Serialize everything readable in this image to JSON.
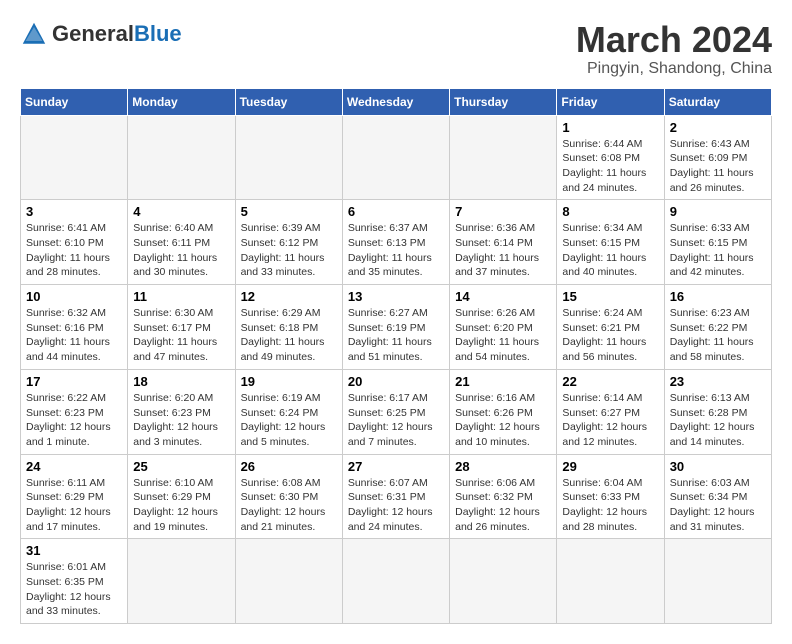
{
  "header": {
    "logo_text_general": "General",
    "logo_text_blue": "Blue",
    "month_title": "March 2024",
    "location": "Pingyin, Shandong, China"
  },
  "days_of_week": [
    "Sunday",
    "Monday",
    "Tuesday",
    "Wednesday",
    "Thursday",
    "Friday",
    "Saturday"
  ],
  "weeks": [
    [
      {
        "day": "",
        "empty": true
      },
      {
        "day": "",
        "empty": true
      },
      {
        "day": "",
        "empty": true
      },
      {
        "day": "",
        "empty": true
      },
      {
        "day": "",
        "empty": true
      },
      {
        "day": "1",
        "sunrise": "6:44 AM",
        "sunset": "6:08 PM",
        "daylight": "11 hours and 24 minutes."
      },
      {
        "day": "2",
        "sunrise": "6:43 AM",
        "sunset": "6:09 PM",
        "daylight": "11 hours and 26 minutes."
      }
    ],
    [
      {
        "day": "3",
        "sunrise": "6:41 AM",
        "sunset": "6:10 PM",
        "daylight": "11 hours and 28 minutes."
      },
      {
        "day": "4",
        "sunrise": "6:40 AM",
        "sunset": "6:11 PM",
        "daylight": "11 hours and 30 minutes."
      },
      {
        "day": "5",
        "sunrise": "6:39 AM",
        "sunset": "6:12 PM",
        "daylight": "11 hours and 33 minutes."
      },
      {
        "day": "6",
        "sunrise": "6:37 AM",
        "sunset": "6:13 PM",
        "daylight": "11 hours and 35 minutes."
      },
      {
        "day": "7",
        "sunrise": "6:36 AM",
        "sunset": "6:14 PM",
        "daylight": "11 hours and 37 minutes."
      },
      {
        "day": "8",
        "sunrise": "6:34 AM",
        "sunset": "6:15 PM",
        "daylight": "11 hours and 40 minutes."
      },
      {
        "day": "9",
        "sunrise": "6:33 AM",
        "sunset": "6:15 PM",
        "daylight": "11 hours and 42 minutes."
      }
    ],
    [
      {
        "day": "10",
        "sunrise": "6:32 AM",
        "sunset": "6:16 PM",
        "daylight": "11 hours and 44 minutes."
      },
      {
        "day": "11",
        "sunrise": "6:30 AM",
        "sunset": "6:17 PM",
        "daylight": "11 hours and 47 minutes."
      },
      {
        "day": "12",
        "sunrise": "6:29 AM",
        "sunset": "6:18 PM",
        "daylight": "11 hours and 49 minutes."
      },
      {
        "day": "13",
        "sunrise": "6:27 AM",
        "sunset": "6:19 PM",
        "daylight": "11 hours and 51 minutes."
      },
      {
        "day": "14",
        "sunrise": "6:26 AM",
        "sunset": "6:20 PM",
        "daylight": "11 hours and 54 minutes."
      },
      {
        "day": "15",
        "sunrise": "6:24 AM",
        "sunset": "6:21 PM",
        "daylight": "11 hours and 56 minutes."
      },
      {
        "day": "16",
        "sunrise": "6:23 AM",
        "sunset": "6:22 PM",
        "daylight": "11 hours and 58 minutes."
      }
    ],
    [
      {
        "day": "17",
        "sunrise": "6:22 AM",
        "sunset": "6:23 PM",
        "daylight": "12 hours and 1 minute."
      },
      {
        "day": "18",
        "sunrise": "6:20 AM",
        "sunset": "6:23 PM",
        "daylight": "12 hours and 3 minutes."
      },
      {
        "day": "19",
        "sunrise": "6:19 AM",
        "sunset": "6:24 PM",
        "daylight": "12 hours and 5 minutes."
      },
      {
        "day": "20",
        "sunrise": "6:17 AM",
        "sunset": "6:25 PM",
        "daylight": "12 hours and 7 minutes."
      },
      {
        "day": "21",
        "sunrise": "6:16 AM",
        "sunset": "6:26 PM",
        "daylight": "12 hours and 10 minutes."
      },
      {
        "day": "22",
        "sunrise": "6:14 AM",
        "sunset": "6:27 PM",
        "daylight": "12 hours and 12 minutes."
      },
      {
        "day": "23",
        "sunrise": "6:13 AM",
        "sunset": "6:28 PM",
        "daylight": "12 hours and 14 minutes."
      }
    ],
    [
      {
        "day": "24",
        "sunrise": "6:11 AM",
        "sunset": "6:29 PM",
        "daylight": "12 hours and 17 minutes."
      },
      {
        "day": "25",
        "sunrise": "6:10 AM",
        "sunset": "6:29 PM",
        "daylight": "12 hours and 19 minutes."
      },
      {
        "day": "26",
        "sunrise": "6:08 AM",
        "sunset": "6:30 PM",
        "daylight": "12 hours and 21 minutes."
      },
      {
        "day": "27",
        "sunrise": "6:07 AM",
        "sunset": "6:31 PM",
        "daylight": "12 hours and 24 minutes."
      },
      {
        "day": "28",
        "sunrise": "6:06 AM",
        "sunset": "6:32 PM",
        "daylight": "12 hours and 26 minutes."
      },
      {
        "day": "29",
        "sunrise": "6:04 AM",
        "sunset": "6:33 PM",
        "daylight": "12 hours and 28 minutes."
      },
      {
        "day": "30",
        "sunrise": "6:03 AM",
        "sunset": "6:34 PM",
        "daylight": "12 hours and 31 minutes."
      }
    ],
    [
      {
        "day": "31",
        "sunrise": "6:01 AM",
        "sunset": "6:35 PM",
        "daylight": "12 hours and 33 minutes."
      },
      {
        "day": "",
        "empty": true
      },
      {
        "day": "",
        "empty": true
      },
      {
        "day": "",
        "empty": true
      },
      {
        "day": "",
        "empty": true
      },
      {
        "day": "",
        "empty": true
      },
      {
        "day": "",
        "empty": true
      }
    ]
  ]
}
